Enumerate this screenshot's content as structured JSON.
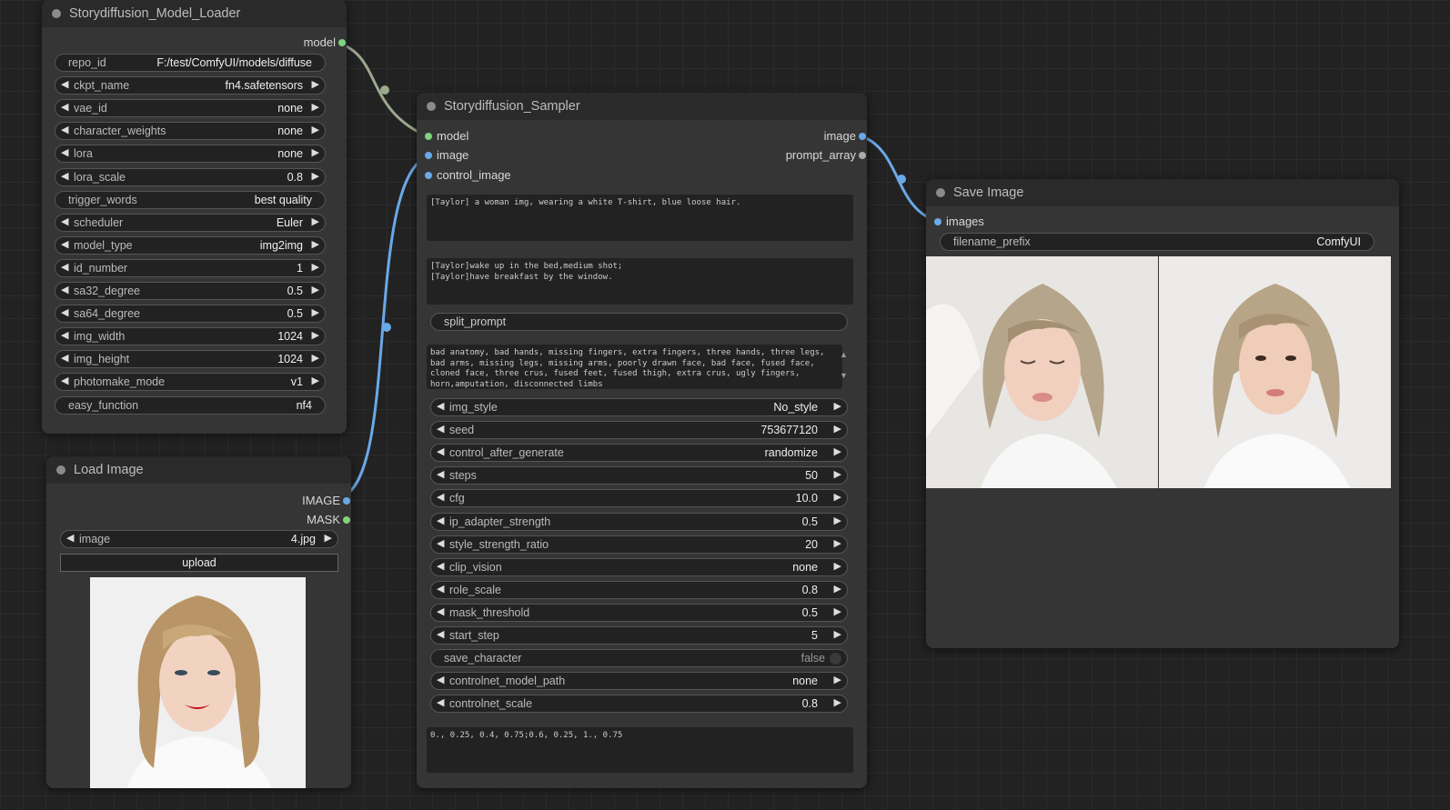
{
  "colors": {
    "model_link": "#9ca88e",
    "image_link": "#6aa9e8",
    "port_model": "#7ed37e",
    "port_image": "#6aa9e8"
  },
  "loader": {
    "title": "Storydiffusion_Model_Loader",
    "output_model": "model",
    "widgets": [
      {
        "label": "repo_id",
        "value": "F:/test/ComfyUI/models/diffuse",
        "arrows": false
      },
      {
        "label": "ckpt_name",
        "value": "fn4.safetensors",
        "arrows": true
      },
      {
        "label": "vae_id",
        "value": "none",
        "arrows": true
      },
      {
        "label": "character_weights",
        "value": "none",
        "arrows": true
      },
      {
        "label": "lora",
        "value": "none",
        "arrows": true
      },
      {
        "label": "lora_scale",
        "value": "0.8",
        "arrows": true
      },
      {
        "label": "trigger_words",
        "value": "best quality",
        "arrows": false
      },
      {
        "label": "scheduler",
        "value": "Euler",
        "arrows": true
      },
      {
        "label": "model_type",
        "value": "img2img",
        "arrows": true
      },
      {
        "label": "id_number",
        "value": "1",
        "arrows": true
      },
      {
        "label": "sa32_degree",
        "value": "0.5",
        "arrows": true
      },
      {
        "label": "sa64_degree",
        "value": "0.5",
        "arrows": true
      },
      {
        "label": "img_width",
        "value": "1024",
        "arrows": true
      },
      {
        "label": "img_height",
        "value": "1024",
        "arrows": true
      },
      {
        "label": "photomake_mode",
        "value": "v1",
        "arrows": true
      },
      {
        "label": "easy_function",
        "value": "nf4",
        "arrows": false
      }
    ]
  },
  "load_image": {
    "title": "Load Image",
    "output_image": "IMAGE",
    "output_mask": "MASK",
    "image_label": "image",
    "image_value": "4.jpg",
    "upload_label": "upload"
  },
  "sampler": {
    "title": "Storydiffusion_Sampler",
    "inputs": [
      "model",
      "image",
      "control_image"
    ],
    "outputs": [
      "image",
      "prompt_array"
    ],
    "character_prompt": "[Taylor] a woman img, wearing a white T-shirt, blue loose hair.",
    "scene_prompts": "[Taylor]wake up in the bed,medium shot;\n[Taylor]have breakfast by the window.",
    "split_prompt": "split_prompt",
    "negative_prompt": "bad anatomy, bad hands, missing fingers, extra fingers, three hands, three legs, bad arms, missing legs, missing arms, poorly drawn face, bad face, fused face, cloned face, three crus, fused feet, fused thigh, extra crus, ugly fingers, horn,amputation, disconnected limbs",
    "widgets": [
      {
        "label": "img_style",
        "value": "No_style",
        "type": "arrows"
      },
      {
        "label": "seed",
        "value": "753677120",
        "type": "arrows"
      },
      {
        "label": "control_after_generate",
        "value": "randomize",
        "type": "arrows"
      },
      {
        "label": "steps",
        "value": "50",
        "type": "arrows"
      },
      {
        "label": "cfg",
        "value": "10.0",
        "type": "arrows"
      },
      {
        "label": "ip_adapter_strength",
        "value": "0.5",
        "type": "arrows"
      },
      {
        "label": "style_strength_ratio",
        "value": "20",
        "type": "arrows"
      },
      {
        "label": "clip_vision",
        "value": "none",
        "type": "arrows"
      },
      {
        "label": "role_scale",
        "value": "0.8",
        "type": "arrows"
      },
      {
        "label": "mask_threshold",
        "value": "0.5",
        "type": "arrows"
      },
      {
        "label": "start_step",
        "value": "5",
        "type": "arrows"
      },
      {
        "label": "save_character",
        "value": "false",
        "type": "toggle"
      },
      {
        "label": "controlnet_model_path",
        "value": "none",
        "type": "arrows"
      },
      {
        "label": "controlnet_scale",
        "value": "0.8",
        "type": "arrows"
      }
    ],
    "guidance_list": "0., 0.25, 0.4, 0.75;0.6, 0.25, 1., 0.75"
  },
  "save_image": {
    "title": "Save Image",
    "input_images": "images",
    "filename_prefix_label": "filename_prefix",
    "filename_prefix_value": "ComfyUI"
  }
}
